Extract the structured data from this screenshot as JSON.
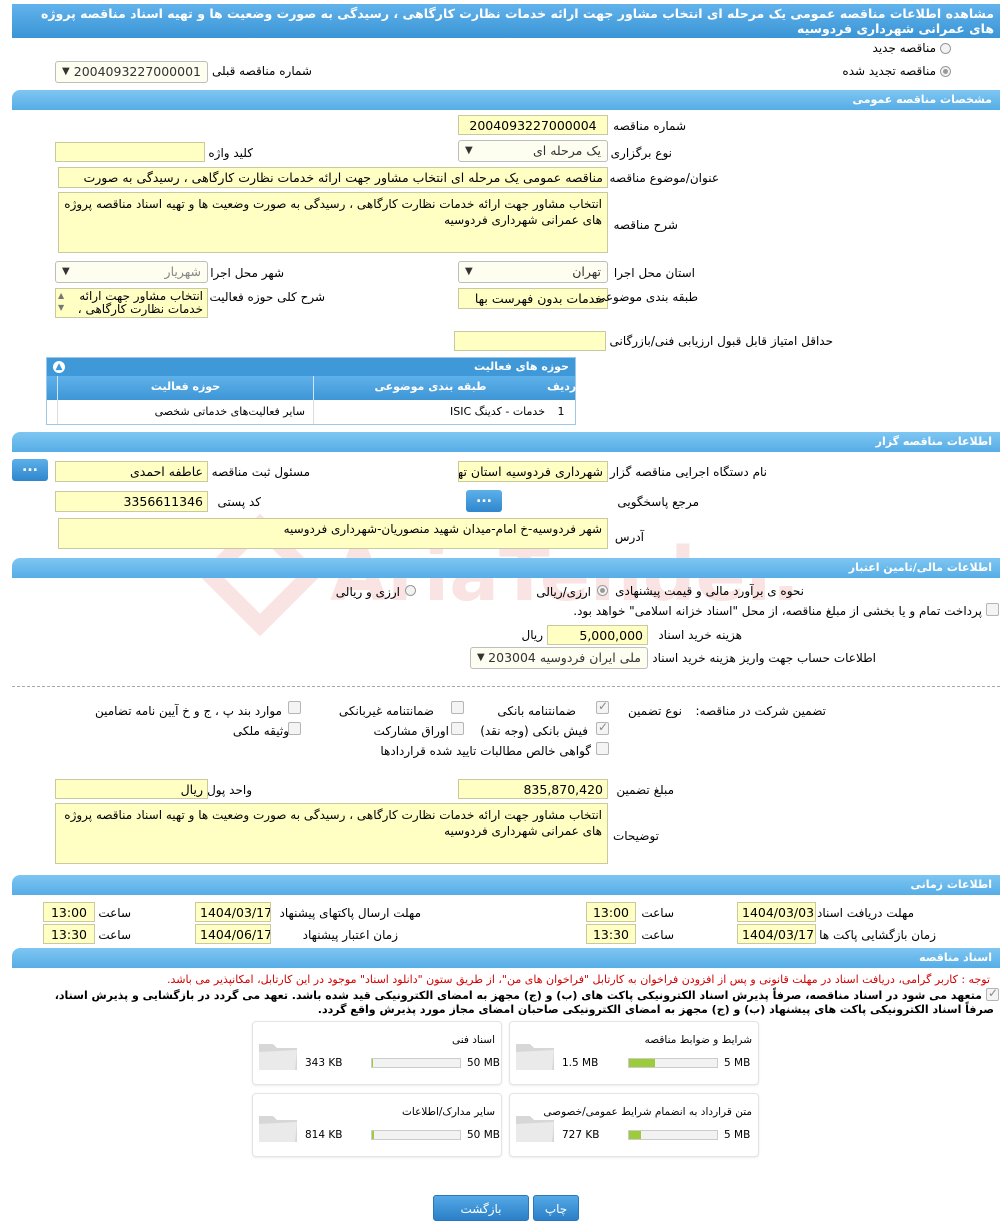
{
  "page": {
    "title": "مشاهده اطلاعات مناقصه عمومی یک مرحله ای انتخاب مشاور جهت ارائه خدمات نظارت کارگاهی ، رسیدگی به صورت وضعیت ها و تهیه اسناد مناقصه پروژه های عمرانی شهرداری فردوسیه"
  },
  "tender_type": {
    "new_label": "مناقصه جدید",
    "renewed_label": "مناقصه تجدید شده",
    "prev_number_label": "شماره مناقصه قبلی",
    "prev_number_value": "2004093227000001"
  },
  "general": {
    "section_title": "مشخصات مناقصه عمومی",
    "number_label": "شماره مناقصه",
    "number_value": "2004093227000004",
    "holding_type_label": "نوع برگزاری",
    "holding_type_value": "یک مرحله ای",
    "keyword_label": "کلید واژه",
    "keyword_value": "",
    "subject_label": "عنوان/موضوع مناقصه",
    "subject_value": "مناقصه عمومی یک مرحله ای انتخاب مشاور جهت ارائه خدمات نظارت کارگاهی ، رسیدگی به صورت",
    "description_label": "شرح مناقصه",
    "description_value": "انتخاب مشاور جهت ارائه خدمات نظارت کارگاهی ، رسیدگی به صورت وضعیت ها و تهیه اسناد مناقصه  پروژه های عمرانی شهرداری فردوسیه",
    "province_label": "استان محل اجرا",
    "province_value": "تهران",
    "city_label": "شهر محل اجرا",
    "city_value": "شهریار",
    "category_label": "طبقه بندی موضوعی",
    "category_value": "خدمات بدون فهرست بها",
    "activity_desc_label": "شرح کلی حوزه فعالیت",
    "activity_desc_value": "انتخاب مشاور جهت ارائه خدمات نظارت کارگاهی ،",
    "min_score_label": "حداقل امتیاز قابل قبول ارزیابی فنی/بازرگانی",
    "min_score_value": ""
  },
  "activity_grid": {
    "title": "حوزه های فعالیت",
    "col_row": "ردیف",
    "col_category": "طبقه بندی موضوعی",
    "col_field": "حوزه فعالیت",
    "rows": [
      {
        "row": "1",
        "category": "خدمات - کدینگ ISIC",
        "field": "سایر فعالیت‌های خدماتی شخصی"
      }
    ]
  },
  "organizer": {
    "section_title": "اطلاعات مناقصه گزار",
    "agency_label": "نام دستگاه اجرایی مناقصه گزار",
    "agency_value": "شهرداری فردوسیه استان تهران",
    "registrar_label": "مسئول ثبت مناقصه",
    "registrar_value": "عاطفه احمدی",
    "reference_label": "مرجع پاسخگویی",
    "postal_label": "کد پستی",
    "postal_value": "3356611346",
    "address_label": "آدرس",
    "address_value": "شهر فردوسیه-خ امام-میدان شهید منصوریان-شهرداری فردوسیه",
    "dots": "..."
  },
  "finance": {
    "section_title": "اطلاعات مالی/تامین اعتبار",
    "estimate_label": "نحوه ی برآورد مالی و قیمت پیشنهادی",
    "opt_rial_fx": "ارزی/ریالی",
    "opt_fx_and_rial": "ارزی و ریالی",
    "treasury_note": "پرداخت تمام و یا بخشی از مبلغ مناقصه، از محل \"اسناد خزانه اسلامی\" خواهد بود.",
    "doc_cost_label": "هزینه خرید اسناد",
    "doc_cost_value": "5,000,000",
    "doc_cost_unit": "ریال",
    "account_label": "اطلاعات حساب جهت واریز هزینه خرید اسناد",
    "account_value": "ملی ایران فردوسیه 203004"
  },
  "guarantee": {
    "participation_label": "تضمین شرکت در مناقصه:",
    "type_label": "نوع تضمین",
    "bank_guarantee": "ضمانتنامه بانکی",
    "nonbank_guarantee": "ضمانتنامه غیربانکی",
    "items_bpjj": "موارد بند پ ، ج و خ آیین نامه تضامین",
    "bank_receipt": "فیش بانکی (وجه نقد)",
    "participation_bonds": "اوراق مشارکت",
    "property_collateral": "وثیقه ملکی",
    "net_claims": "گواهی خالص مطالبات تایید شده قراردادها",
    "amount_label": "مبلغ تضمین",
    "amount_value": "835,870,420",
    "currency_label": "واحد پول",
    "currency_value": "ریال",
    "notes_label": "توضیحات",
    "notes_value": "انتخاب مشاور جهت ارائه خدمات نظارت کارگاهی ، رسیدگی به صورت وضعیت ها و تهیه اسناد مناقصه  پروژه های عمرانی شهرداری فردوسیه"
  },
  "timing": {
    "section_title": "اطلاعات زمانی",
    "receive_deadline_label": "مهلت دریافت اسناد",
    "receive_deadline_date": "1404/03/03",
    "receive_deadline_time": "13:00",
    "send_deadline_label": "مهلت ارسال پاکتهای پیشنهاد",
    "send_deadline_date": "1404/03/17",
    "send_deadline_time": "13:00",
    "opening_label": "زمان بازگشایی پاکت ها",
    "opening_date": "1404/03/17",
    "opening_time": "13:30",
    "validity_label": "زمان اعتبار پیشنهاد",
    "validity_date": "1404/06/17",
    "validity_time": "13:30",
    "time_label": "ساعت"
  },
  "documents": {
    "section_title": "اسناد مناقصه",
    "notice": "توجه : کاربر گرامی، دریافت اسناد در مهلت قانونی و پس از افزودن فراخوان به کارتابل \"فراخوان های من\"، از طریق ستون \"دانلود اسناد\" موجود در این کارتابل، امکانپذیر می باشد.",
    "commitment_1": "متعهد می شود در اسناد مناقصه، صرفاً پذیرش اسناد الکترونیکی پاکت های (ب) و (ج) مجهز به امضای الکترونیکی قید شده باشد. تعهد می گردد در بازگشایی و پذیرش اسناد،",
    "commitment_2": "صرفاً اسناد الکترونیکی پاکت های پیشنهاد (ب) و (ج) مجهز به امضای الکترونیکی صاحبان امضای مجاز مورد پذیرش واقع گردد.",
    "files": [
      {
        "name": "شرایط و ضوابط مناقصه",
        "size": "1.5 MB",
        "max": "5 MB",
        "fill": 0.3
      },
      {
        "name": "اسناد فنی",
        "size": "343 KB",
        "max": "50 MB",
        "fill": 0.01
      },
      {
        "name": "متن قرارداد به انضمام شرایط عمومی/خصوصی",
        "size": "727 KB",
        "max": "5 MB",
        "fill": 0.14
      },
      {
        "name": "سایر مدارک/اطلاعات",
        "size": "814 KB",
        "max": "50 MB",
        "fill": 0.02
      }
    ]
  },
  "buttons": {
    "print": "چاپ",
    "back": "بازگشت"
  },
  "watermark": {
    "text": "AriaTender.neT"
  }
}
